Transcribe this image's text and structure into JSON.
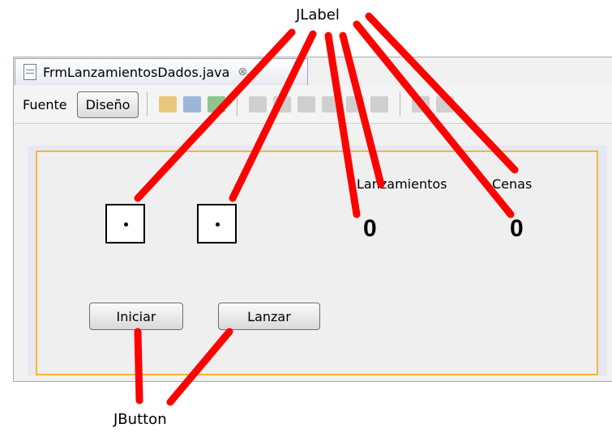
{
  "annotations": {
    "jlabel": "JLabel",
    "jbutton": "JButton"
  },
  "ide": {
    "tab_title": "FrmLanzamientosDados.java",
    "toolbar": {
      "source_label": "Fuente",
      "design_label": "Diseño"
    }
  },
  "form": {
    "lanzamientos_label": "Lanzamientos",
    "cenas_label": "Cenas",
    "lanzamientos_value": "0",
    "cenas_value": "0",
    "start_button": "Iniciar",
    "throw_button": "Lanzar"
  },
  "colors": {
    "annotation_line": "#ff0000",
    "panel_border": "#f7b733"
  }
}
